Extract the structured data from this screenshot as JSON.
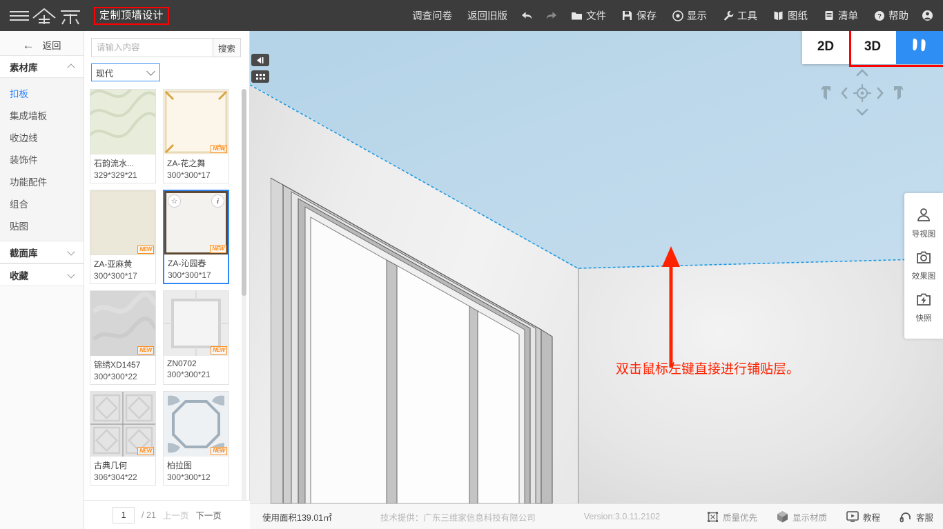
{
  "header": {
    "brand": "三维家",
    "title": "定制顶墙设计",
    "highlight_color": "#ff0000",
    "menu_left": [
      {
        "label": "调查问卷",
        "icon": ""
      },
      {
        "label": "返回旧版",
        "icon": ""
      }
    ],
    "undo_icon": "undo-arrow-icon",
    "redo_icon": "redo-arrow-icon",
    "menu_right": [
      {
        "label": "文件",
        "icon": "folder-icon"
      },
      {
        "label": "保存",
        "icon": "save-disk-icon"
      },
      {
        "label": "显示",
        "icon": "display-target-icon"
      },
      {
        "label": "工具",
        "icon": "wrench-icon"
      },
      {
        "label": "图纸",
        "icon": "book-icon"
      },
      {
        "label": "清单",
        "icon": "list-icon"
      },
      {
        "label": "帮助",
        "icon": "question-circle-icon"
      }
    ],
    "avatar_icon": "user-avatar-icon"
  },
  "sidebar": {
    "back_label": "返回",
    "groups": [
      {
        "title": "素材库",
        "expanded": true,
        "items": [
          {
            "label": "扣板",
            "active": true
          },
          {
            "label": "集成墙板",
            "active": false
          },
          {
            "label": "收边线",
            "active": false
          },
          {
            "label": "装饰件",
            "active": false
          },
          {
            "label": "功能配件",
            "active": false
          },
          {
            "label": "组合",
            "active": false
          },
          {
            "label": "贴图",
            "active": false
          }
        ]
      },
      {
        "title": "截面库",
        "expanded": false,
        "items": []
      },
      {
        "title": "收藏",
        "expanded": false,
        "items": []
      }
    ]
  },
  "material_panel": {
    "search": {
      "placeholder": "请输入内容",
      "value": "",
      "button_label": "搜索"
    },
    "category": {
      "selected": "现代"
    },
    "items": [
      {
        "name": "石韵流水...",
        "size": "329*329*21",
        "new": false,
        "selected": false,
        "swatch": "wave-beige"
      },
      {
        "name": "ZA-花之舞",
        "size": "300*300*17",
        "new": true,
        "selected": false,
        "swatch": "cream-frame"
      },
      {
        "name": "ZA-亚麻黄",
        "size": "300*300*17",
        "new": true,
        "selected": false,
        "swatch": "linen-yellow"
      },
      {
        "name": "ZA-沁园春",
        "size": "300*300*17",
        "new": true,
        "selected": true,
        "swatch": "white-brownframe"
      },
      {
        "name": "锦绣XD1457",
        "size": "300*300*22",
        "new": true,
        "selected": false,
        "swatch": "gray-marble"
      },
      {
        "name": "ZN0702",
        "size": "300*300*21",
        "new": true,
        "selected": false,
        "swatch": "square-panel"
      },
      {
        "name": "古典几何",
        "size": "306*304*22",
        "new": true,
        "selected": false,
        "swatch": "geometric"
      },
      {
        "name": "柏拉图",
        "size": "300*300*12",
        "new": true,
        "selected": false,
        "swatch": "octagon-ornate"
      }
    ],
    "card_icons": {
      "favorite": "star-icon",
      "info": "info-icon"
    },
    "badge_text": "NEW",
    "pager": {
      "current": "1",
      "total": "/ 21",
      "prev": "上一页",
      "next": "下一页"
    }
  },
  "canvas": {
    "collapse_icon": "collapse-panel-icon",
    "grid_icon": "grid-apps-icon",
    "view_modes": [
      {
        "label": "2D",
        "active": false,
        "type": "text"
      },
      {
        "label": "3D",
        "active": false,
        "type": "text"
      },
      {
        "label": "",
        "active": true,
        "type": "walkthrough-icon"
      }
    ],
    "view_highlight_color": "#ff0000",
    "nav_pad": {
      "up": "chevron-up-icon",
      "down": "chevron-down-icon",
      "left": "chevron-left-icon",
      "right": "chevron-right-icon",
      "center": "target-crosshair-icon",
      "rotate_left": "rotate-left-icon",
      "rotate_right": "rotate-right-icon"
    },
    "right_tools": [
      {
        "label": "导视图",
        "icon": "person-view-icon"
      },
      {
        "label": "效果图",
        "icon": "camera-icon"
      },
      {
        "label": "快照",
        "icon": "snapshot-flash-icon"
      }
    ],
    "annotation": {
      "text": "双击鼠标左键直接进行铺贴层。",
      "color": "#ff2200",
      "arrow_icon": "up-arrow-annotation"
    },
    "ceiling_color": "#bcd8ea",
    "selection_outline_color": "#1f9ae0"
  },
  "statusbar": {
    "area_label": "使用面积139.01㎡",
    "provider": "技术提供：广东三维家信息科技有限公司",
    "version": "Version:3.0.11.2102",
    "tools": [
      {
        "label": "质量优先",
        "icon": "quality-cube-icon"
      },
      {
        "label": "显示材质",
        "icon": "material-cube-icon"
      },
      {
        "label": "教程",
        "icon": "tutorial-screen-icon"
      },
      {
        "label": "客服",
        "icon": "headset-icon"
      }
    ]
  }
}
